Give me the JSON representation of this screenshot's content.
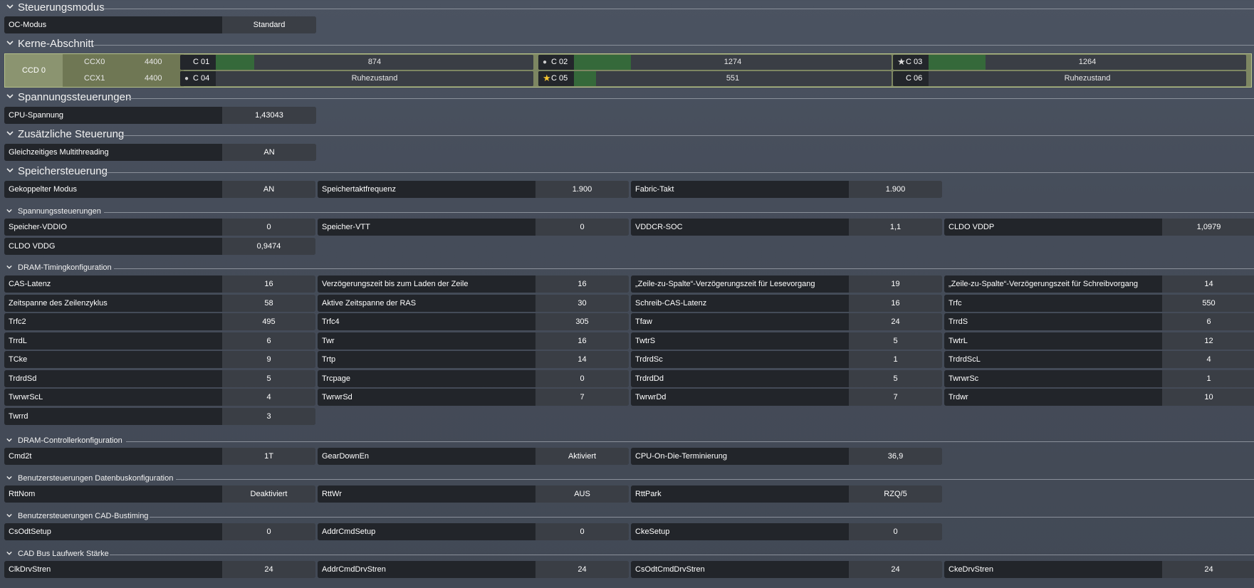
{
  "sections": {
    "steuerungsmodus": "Steuerungsmodus",
    "kerne": "Kerne-Abschnitt",
    "spannung": "Spannungssteuerungen",
    "zusaetzlich": "Zusätzliche Steuerung",
    "speicher": "Speichersteuerung",
    "spannung2": "Spannungssteuerungen",
    "dram_timing": "DRAM-Timingkonfiguration",
    "dram_ctrl": "DRAM-Controllerkonfiguration",
    "datenbus": "Benutzersteuerungen Datenbuskonfiguration",
    "cad_bustiming": "Benutzersteuerungen CAD-Bustiming",
    "cad_drive": "CAD Bus Laufwerk Stärke"
  },
  "oc_mode": {
    "label": "OC-Modus",
    "value": "Standard"
  },
  "cores": {
    "ccd": "CCD 0",
    "ccx": [
      {
        "name": "CCX0",
        "freq": "4400"
      },
      {
        "name": "CCX1",
        "freq": "4400"
      }
    ],
    "list": [
      {
        "name": "C 01",
        "icon": "none",
        "value": "874",
        "load": 0.12
      },
      {
        "name": "C 02",
        "icon": "dot-icon",
        "value": "1274",
        "load": 0.18
      },
      {
        "name": "C 03",
        "icon": "star-white-icon",
        "value": "1264",
        "load": 0.18
      },
      {
        "name": "C 04",
        "icon": "dot-icon",
        "value": "Ruhezustand",
        "load": 0
      },
      {
        "name": "C 05",
        "icon": "star-gold-icon",
        "value": "551",
        "load": 0.07
      },
      {
        "name": "C 06",
        "icon": "none",
        "value": "Ruhezustand",
        "load": 0
      }
    ]
  },
  "cpu_voltage": {
    "label": "CPU-Spannung",
    "value": "1,43043"
  },
  "smt": {
    "label": "Gleichzeitiges Multithreading",
    "value": "AN"
  },
  "memory": [
    {
      "label": "Gekoppelter Modus",
      "value": "AN"
    },
    {
      "label": "Speichertaktfrequenz",
      "value": "1.900"
    },
    {
      "label": "Fabric-Takt",
      "value": "1.900"
    }
  ],
  "mem_voltage": [
    {
      "label": "Speicher-VDDIO",
      "value": "0"
    },
    {
      "label": "Speicher-VTT",
      "value": "0"
    },
    {
      "label": "VDDCR-SOC",
      "value": "1,1"
    },
    {
      "label": "CLDO VDDP",
      "value": "1,0979"
    },
    {
      "label": "CLDO VDDG",
      "value": "0,9474"
    }
  ],
  "dram_timing": [
    {
      "label": "CAS-Latenz",
      "value": "16"
    },
    {
      "label": "Verzögerungszeit bis zum Laden der Zeile",
      "value": "16"
    },
    {
      "label": "„Zeile-zu-Spalte“-Verzögerungszeit für Lesevorgang",
      "value": "19"
    },
    {
      "label": "„Zeile-zu-Spalte“-Verzögerungszeit für Schreibvorgang",
      "value": "14"
    },
    {
      "label": "Zeitspanne des Zeilenzyklus",
      "value": "58"
    },
    {
      "label": "Aktive Zeitspanne der RAS",
      "value": "30"
    },
    {
      "label": "Schreib-CAS-Latenz",
      "value": "16"
    },
    {
      "label": "Trfc",
      "value": "550"
    },
    {
      "label": "Trfc2",
      "value": "495"
    },
    {
      "label": "Trfc4",
      "value": "305"
    },
    {
      "label": "Tfaw",
      "value": "24"
    },
    {
      "label": "TrrdS",
      "value": "6"
    },
    {
      "label": "TrrdL",
      "value": "6"
    },
    {
      "label": "Twr",
      "value": "16"
    },
    {
      "label": "TwtrS",
      "value": "5"
    },
    {
      "label": "TwtrL",
      "value": "12"
    },
    {
      "label": "TCke",
      "value": "9"
    },
    {
      "label": "Trtp",
      "value": "14"
    },
    {
      "label": "TrdrdSc",
      "value": "1"
    },
    {
      "label": "TrdrdScL",
      "value": "4"
    },
    {
      "label": "TrdrdSd",
      "value": "5"
    },
    {
      "label": "Trcpage",
      "value": "0"
    },
    {
      "label": "TrdrdDd",
      "value": "5"
    },
    {
      "label": "TwrwrSc",
      "value": "1"
    },
    {
      "label": "TwrwrScL",
      "value": "4"
    },
    {
      "label": "TwrwrSd",
      "value": "7"
    },
    {
      "label": "TwrwrDd",
      "value": "7"
    },
    {
      "label": "Trdwr",
      "value": "10"
    },
    {
      "label": "Twrrd",
      "value": "3"
    }
  ],
  "dram_ctrl": [
    {
      "label": "Cmd2t",
      "value": "1T"
    },
    {
      "label": "GearDownEn",
      "value": "Aktiviert"
    },
    {
      "label": "CPU-On-Die-Terminierung",
      "value": "36,9"
    }
  ],
  "datenbus": [
    {
      "label": "RttNom",
      "value": "Deaktiviert"
    },
    {
      "label": "RttWr",
      "value": "AUS"
    },
    {
      "label": "RttPark",
      "value": "RZQ/5"
    }
  ],
  "cad_bustiming": [
    {
      "label": "CsOdtSetup",
      "value": "0"
    },
    {
      "label": "AddrCmdSetup",
      "value": "0"
    },
    {
      "label": "CkeSetup",
      "value": "0"
    }
  ],
  "cad_drive": [
    {
      "label": "ClkDrvStren",
      "value": "24"
    },
    {
      "label": "AddrCmdDrvStren",
      "value": "24"
    },
    {
      "label": "CsOdtCmdDrvStren",
      "value": "24"
    },
    {
      "label": "CkeDrvStren",
      "value": "24"
    }
  ]
}
